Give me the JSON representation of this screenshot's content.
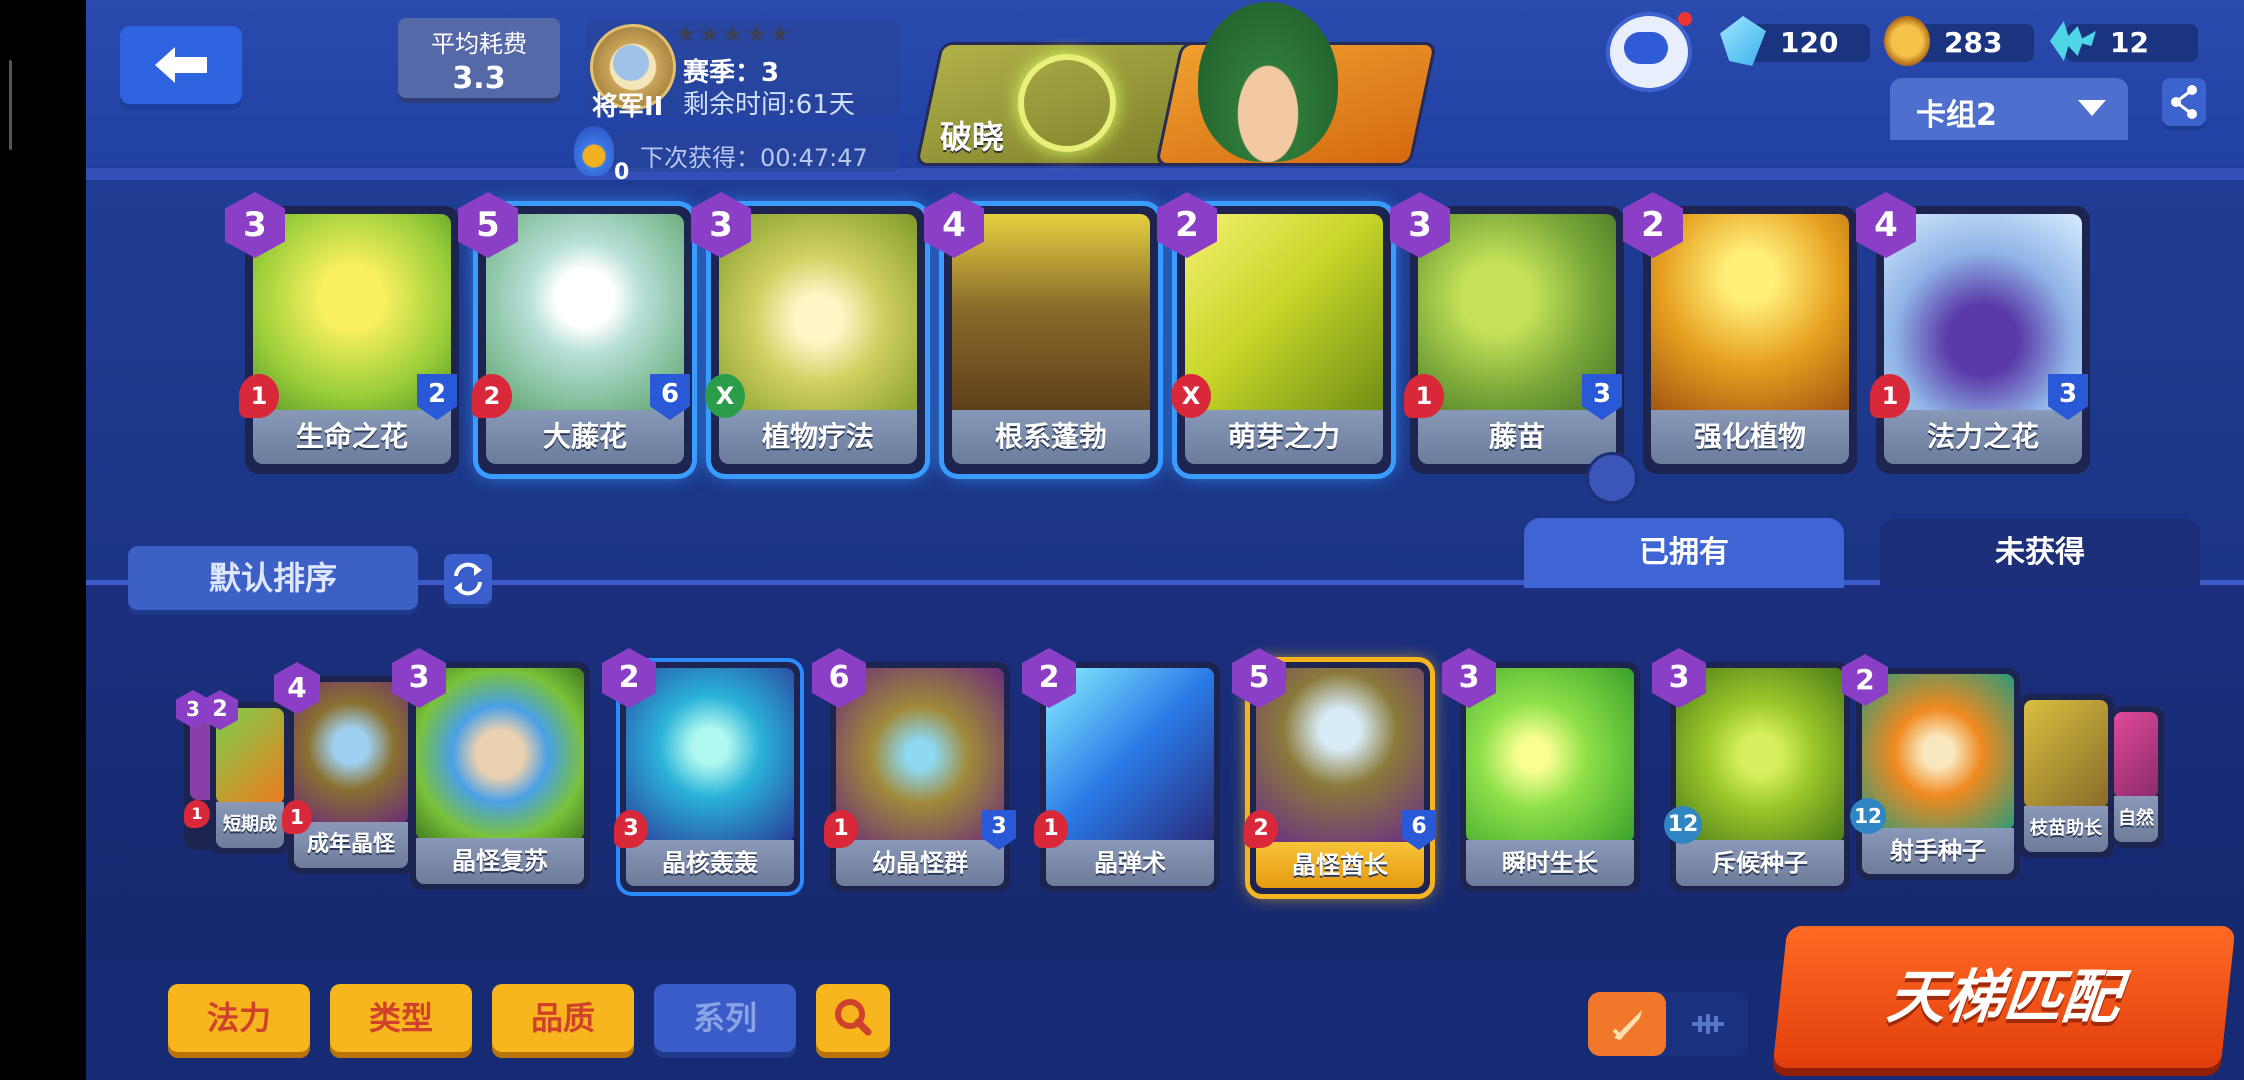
{
  "header": {
    "avg_cost_label": "平均耗费",
    "avg_cost_value": "3.3",
    "rank_name": "将军II",
    "season": "赛季：3",
    "remaining": "剩余时间:61天",
    "potion_count": "0",
    "next_reward": "下次获得：00:47:47",
    "hero_name": "破晓",
    "currencies": [
      {
        "icon": "crystal-icon",
        "value": "120"
      },
      {
        "icon": "coin-icon",
        "value": "283"
      },
      {
        "icon": "fishbone-icon",
        "value": "12"
      }
    ],
    "deck_name": "卡组2"
  },
  "deck": [
    {
      "name": "生命之花",
      "cost": "3",
      "atk": "1",
      "hp": "2",
      "selected": false,
      "art": "#9ccf3a"
    },
    {
      "name": "大藤花",
      "cost": "5",
      "atk": "2",
      "hp": "6",
      "selected": true,
      "art": "#6fb84a"
    },
    {
      "name": "植物疗法",
      "cost": "3",
      "atk": "X",
      "hp": "",
      "selected": true,
      "art": "#b2c454"
    },
    {
      "name": "根系蓬勃",
      "cost": "4",
      "atk": "",
      "hp": "",
      "selected": true,
      "art": "#8a6a2a"
    },
    {
      "name": "萌芽之力",
      "cost": "2",
      "atk": "X",
      "hp": "",
      "selected": true,
      "art": "#c8d62a"
    },
    {
      "name": "藤苗",
      "cost": "3",
      "atk": "1",
      "hp": "3",
      "selected": false,
      "art": "#7aa83a"
    },
    {
      "name": "强化植物",
      "cost": "2",
      "atk": "",
      "hp": "",
      "selected": false,
      "art": "#e6a020"
    },
    {
      "name": "法力之花",
      "cost": "4",
      "atk": "1",
      "hp": "3",
      "selected": false,
      "art": "#8fb4e6"
    }
  ],
  "collection": {
    "sort_label": "默认排序",
    "tab_owned": "已拥有",
    "tab_unowned": "未获得",
    "cards": [
      {
        "name": "",
        "cost": "3",
        "atk": "1",
        "hp": ""
      },
      {
        "name": "短期成",
        "cost": "2",
        "atk": "",
        "hp": ""
      },
      {
        "name": "成年晶怪",
        "cost": "4",
        "atk": "1",
        "hp": ""
      },
      {
        "name": "晶怪复苏",
        "cost": "3",
        "atk": "",
        "hp": ""
      },
      {
        "name": "晶核轰轰",
        "cost": "2",
        "atk": "3",
        "hp": ""
      },
      {
        "name": "幼晶怪群",
        "cost": "6",
        "atk": "1",
        "hp": "3"
      },
      {
        "name": "晶弹术",
        "cost": "2",
        "atk": "1",
        "hp": ""
      },
      {
        "name": "晶怪酋长",
        "cost": "5",
        "atk": "2",
        "hp": "6"
      },
      {
        "name": "瞬时生长",
        "cost": "3",
        "atk": "",
        "hp": ""
      },
      {
        "name": "斥候种子",
        "cost": "3",
        "atk": "",
        "hp": "12"
      },
      {
        "name": "射手种子",
        "cost": "2",
        "atk": "",
        "hp": "12"
      },
      {
        "name": "枝苗助长",
        "cost": "",
        "atk": "",
        "hp": ""
      },
      {
        "name": "自然",
        "cost": "",
        "atk": "",
        "hp": ""
      }
    ]
  },
  "filters": {
    "mana": "法力",
    "type": "类型",
    "quality": "品质",
    "series": "系列"
  },
  "ladder_label": "天梯匹配"
}
